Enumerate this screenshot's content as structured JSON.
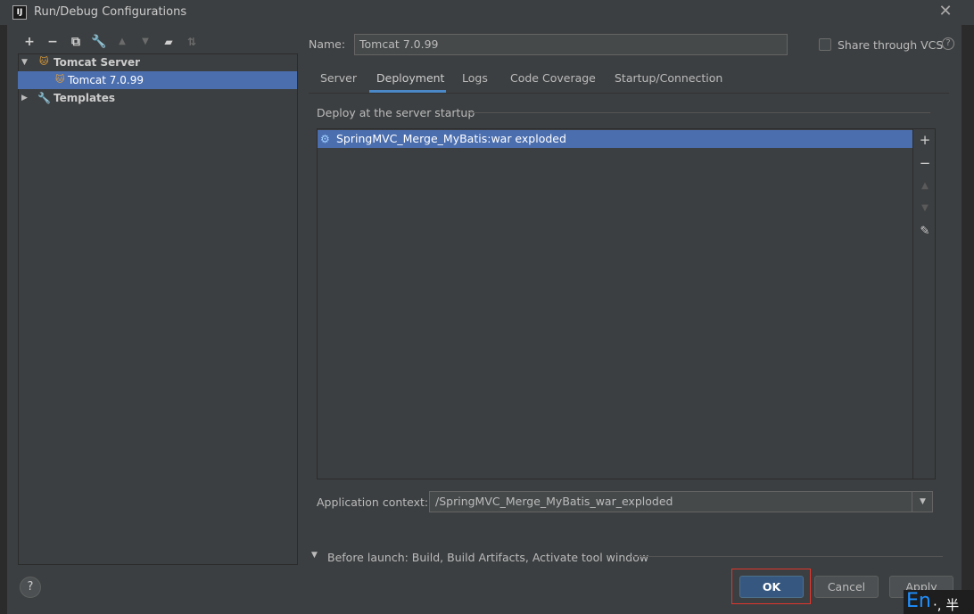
{
  "window": {
    "title": "Run/Debug Configurations",
    "logo": "IJ"
  },
  "toolbar": {
    "icons": [
      "add-icon",
      "remove-icon",
      "copy-icon",
      "wrench-icon",
      "move-up-icon",
      "move-down-icon",
      "folder-icon",
      "sort-icon"
    ]
  },
  "tree": {
    "group": "Tomcat Server",
    "child": "Tomcat 7.0.99",
    "templates": "Templates"
  },
  "name": {
    "label": "Name:",
    "value": "Tomcat 7.0.99"
  },
  "share": {
    "label": "Share through VCS",
    "checked": false
  },
  "tabs": [
    {
      "label": "Server"
    },
    {
      "label": "Deployment"
    },
    {
      "label": "Logs"
    },
    {
      "label": "Code Coverage"
    },
    {
      "label": "Startup/Connection"
    }
  ],
  "active_tab": "Deployment",
  "deployment": {
    "group_title": "Deploy at the server startup",
    "artifacts": [
      "SpringMVC_Merge_MyBatis:war exploded"
    ],
    "context_label": "Application context:",
    "context_value": "/SpringMVC_Merge_MyBatis_war_exploded"
  },
  "before_launch": "Before launch: Build, Build Artifacts, Activate tool window",
  "buttons": {
    "ok": "OK",
    "cancel": "Cancel",
    "apply": "Apply",
    "help": "?"
  },
  "ime": {
    "lang": "En",
    "rest": "·, 半"
  },
  "colors": {
    "accent": "#4b6eaf",
    "ok_button": "#365880",
    "highlight": "#e0362d"
  }
}
